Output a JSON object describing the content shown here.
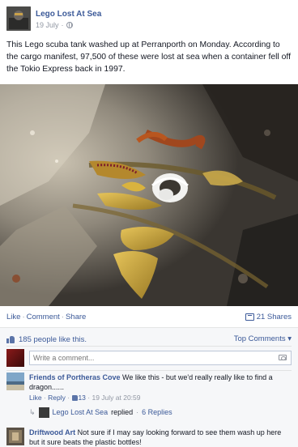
{
  "post": {
    "page_name": "Lego Lost At Sea",
    "date": "19 July",
    "text": "This Lego scuba tank washed up at Perranporth on Monday. According to the cargo manifest, 97,500 of these were lost at sea when a container fell off the Tokio Express back in 1997."
  },
  "actions": {
    "like": "Like",
    "comment": "Comment",
    "share": "Share",
    "shares_count": "21 Shares"
  },
  "feedback": {
    "likes_text": "185 people like this.",
    "top_comments": "Top Comments ▾",
    "write_placeholder": "Write a comment..."
  },
  "comments": [
    {
      "author": "Friends of Portheras Cove",
      "text": "We like this - but we'd really really like to find a dragon......",
      "like": "Like",
      "reply": "Reply",
      "likes": "13",
      "time": "19 July at 20:59"
    },
    {
      "author": "Driftwood Art",
      "text": "Not sure if I may say looking forward to see them wash up here but it sure beats the plastic bottles!"
    }
  ],
  "replies": {
    "author": "Lego Lost At Sea",
    "replied": "replied",
    "count": "6 Replies"
  },
  "icons": [
    "globe-icon",
    "share-icon",
    "thumbs-up-icon",
    "camera-icon",
    "reply-arrow-icon"
  ],
  "colors": {
    "link": "#3b5998",
    "muted": "#9197a3",
    "feedback_bg": "#f6f7f9"
  }
}
